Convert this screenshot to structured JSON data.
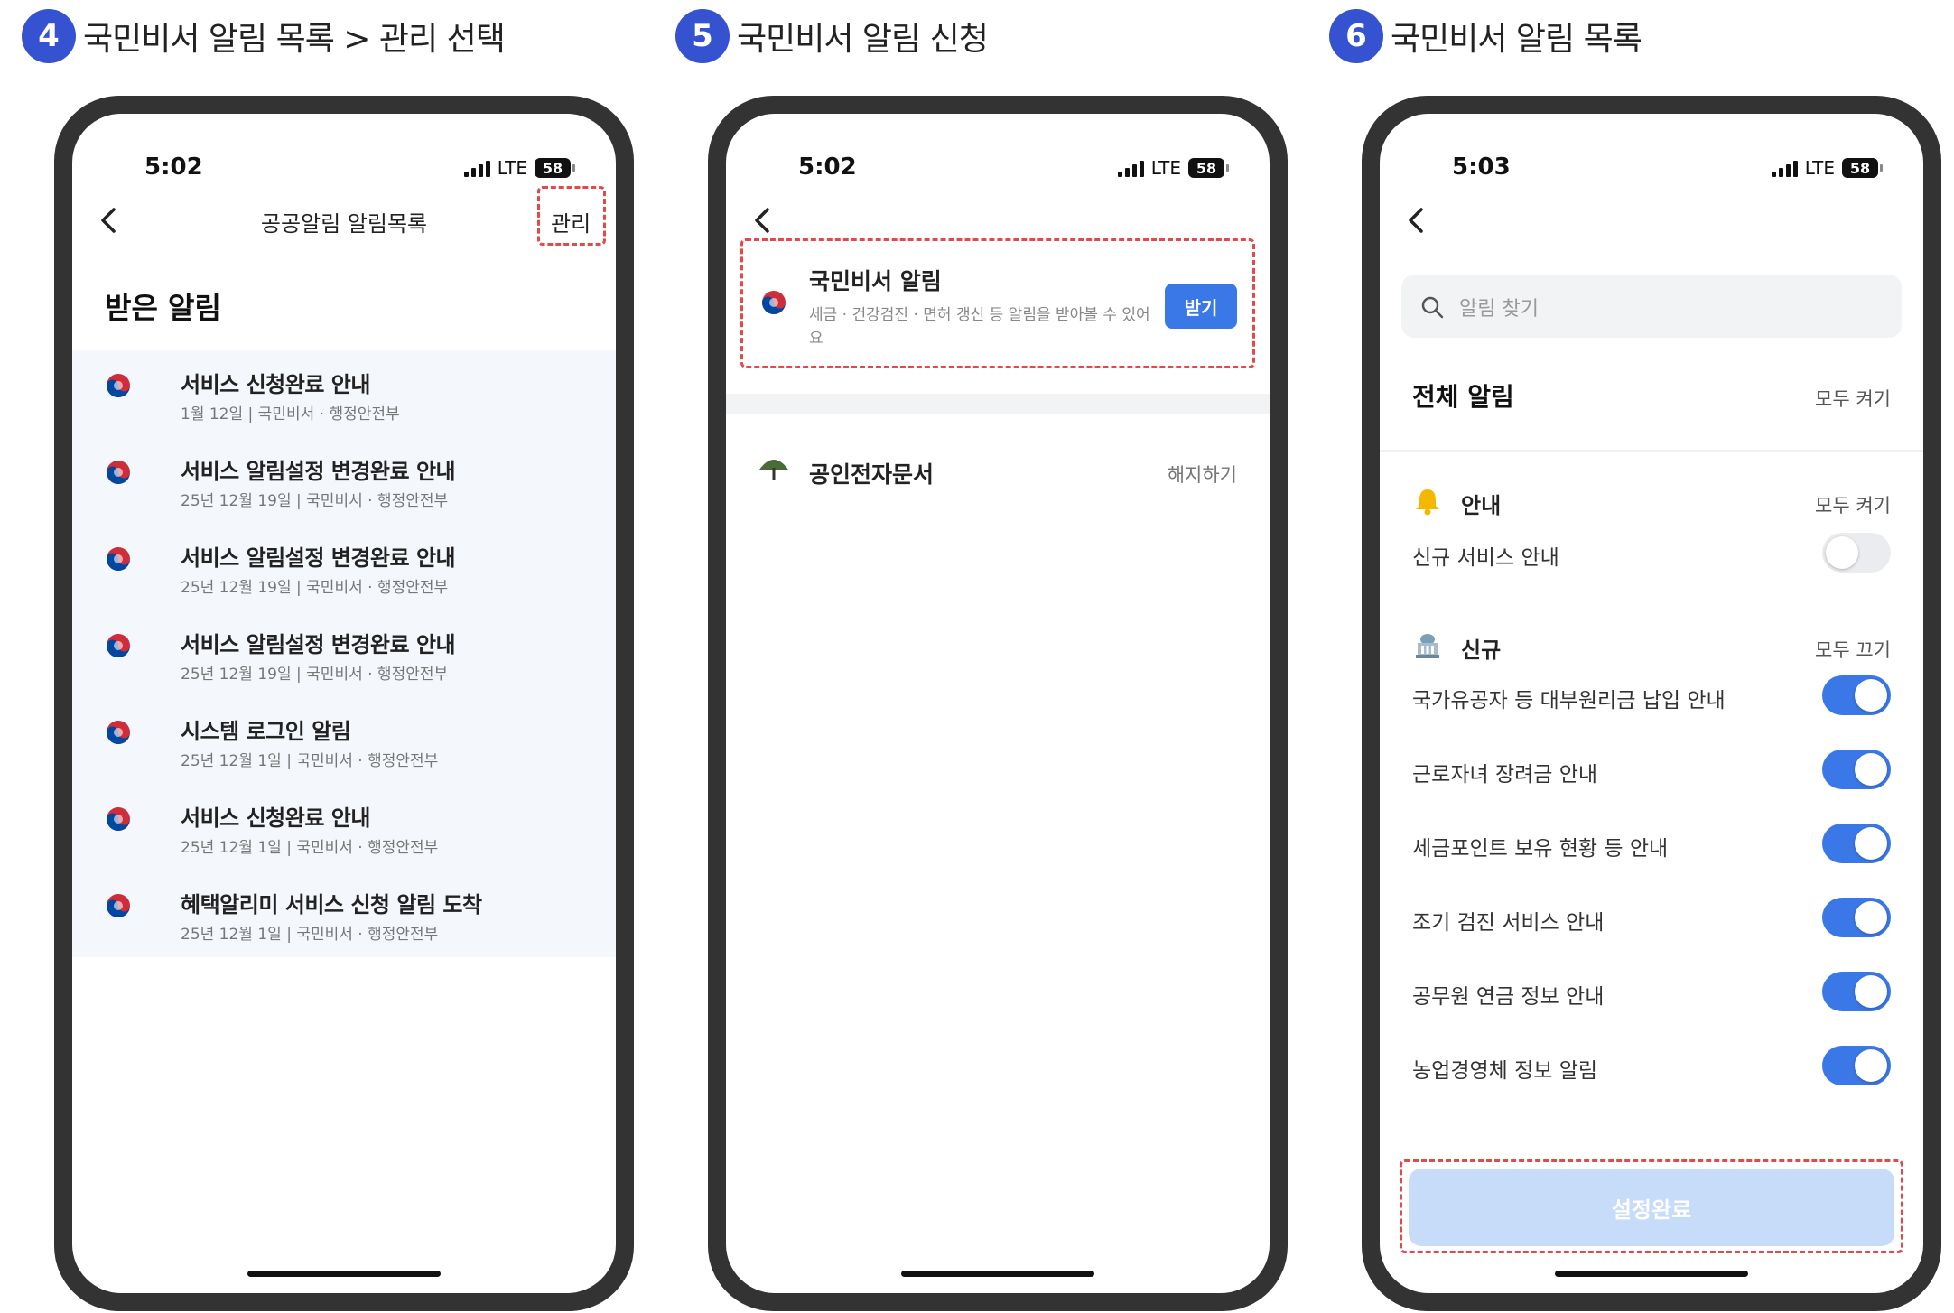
{
  "steps": [
    {
      "number": "4",
      "title": "국민비서 알림 목록 > 관리 선택"
    },
    {
      "number": "5",
      "title": "국민비서 알림 신청"
    },
    {
      "number": "6",
      "title": "국민비서 알림 목록"
    }
  ],
  "phone1": {
    "status": {
      "time": "5:02",
      "network": "LTE",
      "battery": "58"
    },
    "nav": {
      "title": "공공알림 알림목록",
      "manage_label": "관리"
    },
    "section_title": "받은 알림",
    "notifications": [
      {
        "title": "서비스 신청완료 안내",
        "meta": "1월 12일 | 국민비서 · 행정안전부"
      },
      {
        "title": "서비스 알림설정 변경완료 안내",
        "meta": "25년 12월 19일 | 국민비서 · 행정안전부"
      },
      {
        "title": "서비스 알림설정 변경완료 안내",
        "meta": "25년 12월 19일 | 국민비서 · 행정안전부"
      },
      {
        "title": "서비스 알림설정 변경완료 안내",
        "meta": "25년 12월 19일 | 국민비서 · 행정안전부"
      },
      {
        "title": "시스템 로그인 알림",
        "meta": "25년 12월 1일 | 국민비서 · 행정안전부"
      },
      {
        "title": "서비스 신청완료 안내",
        "meta": "25년 12월 1일 | 국민비서 · 행정안전부"
      },
      {
        "title": "혜택알리미 서비스 신청 알림 도착",
        "meta": "25년 12월 1일 | 국민비서 · 행정안전부"
      }
    ]
  },
  "phone2": {
    "status": {
      "time": "5:02",
      "network": "LTE",
      "battery": "58"
    },
    "service": {
      "title": "국민비서 알림",
      "desc": "세금 · 건강검진 · 면허 갱신 등 알림을 받아볼 수 있어요",
      "button": "받기"
    },
    "cert": {
      "title": "공인전자문서",
      "action": "해지하기"
    }
  },
  "phone3": {
    "status": {
      "time": "5:03",
      "network": "LTE",
      "battery": "58"
    },
    "search_placeholder": "알림 찾기",
    "all": {
      "title": "전체 알림",
      "action": "모두 켜기"
    },
    "group1": {
      "title": "안내",
      "action": "모두 켜기",
      "items": [
        {
          "label": "신규 서비스 안내",
          "on": false
        }
      ]
    },
    "group2": {
      "title": "신규",
      "action": "모두 끄기",
      "items": [
        {
          "label": "국가유공자 등 대부원리금 납입 안내",
          "on": true
        },
        {
          "label": "근로자녀 장려금 안내",
          "on": true
        },
        {
          "label": "세금포인트 보유 현황 등 안내",
          "on": true
        },
        {
          "label": "조기 검진 서비스 안내",
          "on": true
        },
        {
          "label": "공무원 연금 정보 안내",
          "on": true
        },
        {
          "label": "농업경영체 정보 알림",
          "on": true
        }
      ]
    },
    "confirm_button": "설정완료"
  },
  "colors": {
    "accent": "#3b78e7",
    "badge": "#3552d1",
    "highlight": "#e04a4a",
    "frame": "#333333"
  }
}
